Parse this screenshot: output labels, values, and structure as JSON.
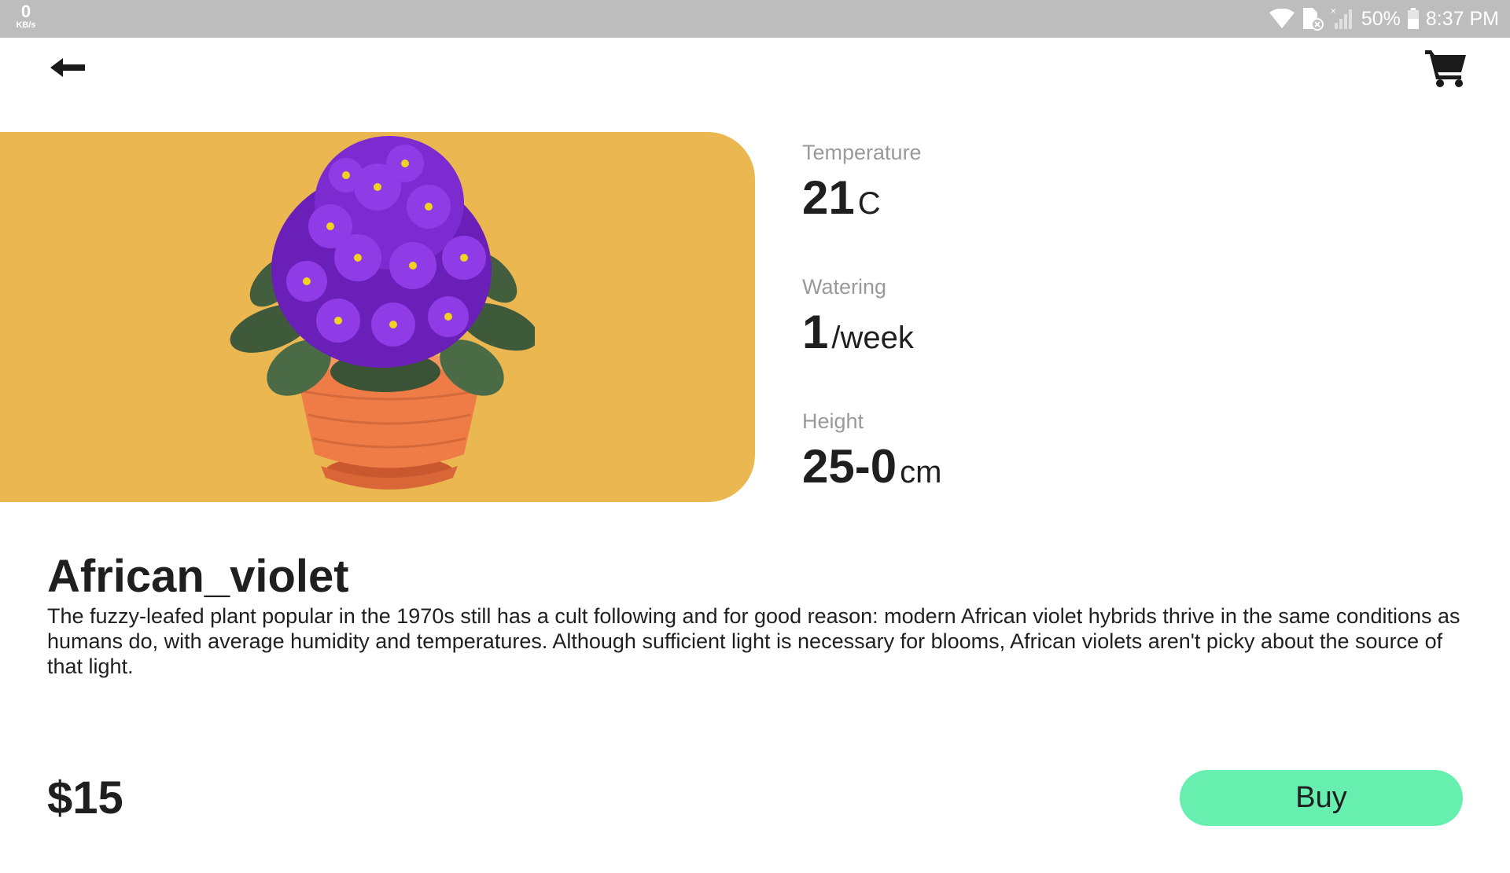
{
  "status_bar": {
    "net_speed_value": "0",
    "net_speed_unit": "KB/s",
    "battery": "50%",
    "time": "8:37 PM",
    "icons": [
      "wifi-icon",
      "sim-missing-icon",
      "signal-icon",
      "battery-icon"
    ]
  },
  "app_bar": {
    "back_icon": "arrow-left-icon",
    "cart_icon": "shopping-cart-icon"
  },
  "hero": {
    "background_color": "#ebb751",
    "image": "african-violet-plant"
  },
  "specs": [
    {
      "label": "Temperature",
      "value": "21",
      "unit": "C"
    },
    {
      "label": "Watering",
      "value": "1",
      "unit": "/week"
    },
    {
      "label": "Height",
      "value": "25-0",
      "unit": "cm"
    }
  ],
  "plant": {
    "name": "African_violet",
    "description": "The fuzzy-leafed plant popular in the 1970s still has a cult following and for good reason: modern African violet hybrids thrive in the same conditions as humans do, with average humidity and temperatures. Although sufficient light is necessary for blooms, African violets aren't picky about the source of that light."
  },
  "purchase": {
    "price": "$15",
    "buy_label": "Buy",
    "button_color": "#67efaf"
  }
}
